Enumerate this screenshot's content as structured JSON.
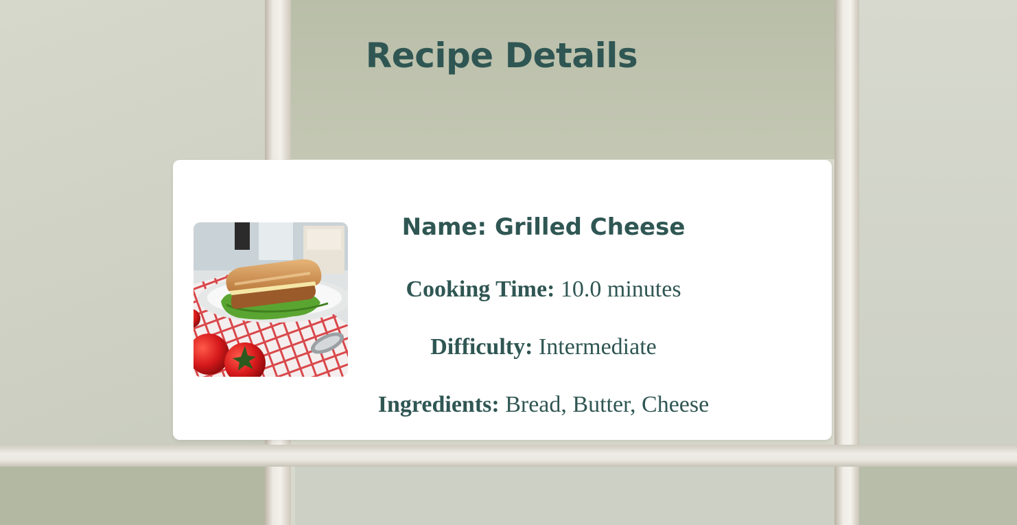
{
  "page": {
    "title": "Recipe Details"
  },
  "recipe": {
    "name_label": "Name:",
    "name": "Grilled Cheese",
    "cooking_time_label": "Cooking Time:",
    "cooking_time": "10.0 minutes",
    "difficulty_label": "Difficulty:",
    "difficulty": "Intermediate",
    "ingredients_label": "Ingredients:",
    "ingredients": "Bread, Butter, Cheese",
    "image_icon": "grilled-cheese-sandwich-photo"
  },
  "colors": {
    "text_accent": "#2f5653",
    "card_background": "#ffffff"
  }
}
